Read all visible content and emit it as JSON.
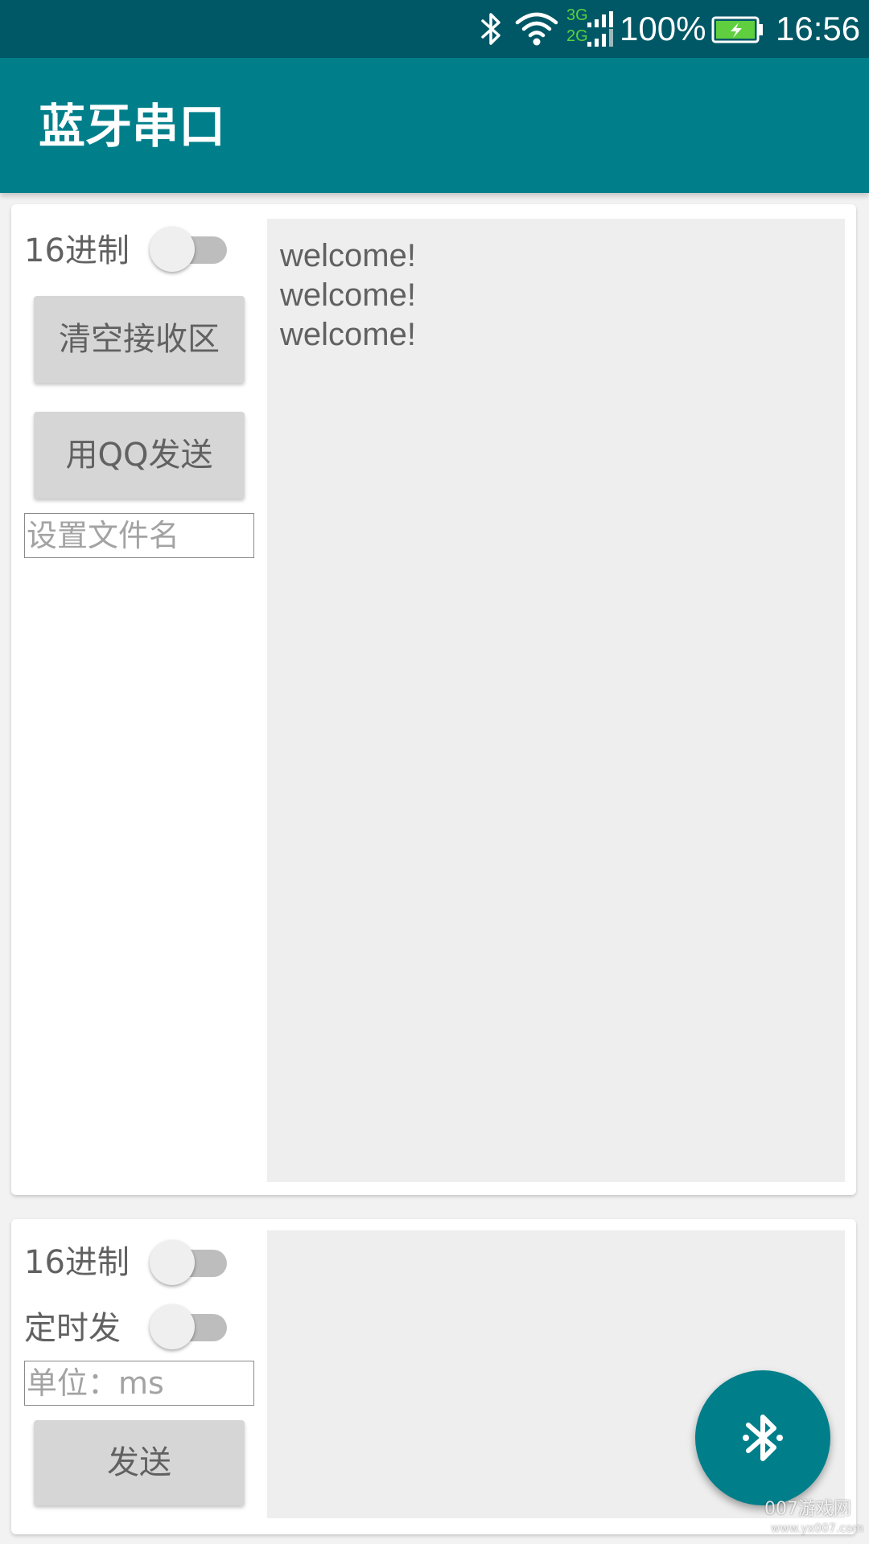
{
  "status_bar": {
    "network_3g": "3G",
    "network_2g": "2G",
    "battery": "100%",
    "time": "16:56",
    "icons": [
      "bluetooth-icon",
      "wifi-icon",
      "signal-icon",
      "battery-charging-icon"
    ]
  },
  "app_bar": {
    "title": "蓝牙串口"
  },
  "receive": {
    "hex_label": "16进制",
    "hex_enabled": false,
    "clear_button": "清空接收区",
    "qq_button": "用QQ发送",
    "filename_placeholder": "设置文件名",
    "filename_value": "",
    "lines": [
      "welcome!",
      "welcome!",
      "welcome!"
    ]
  },
  "send": {
    "hex_label": "16进制",
    "hex_enabled": false,
    "timer_label": "定时发",
    "timer_enabled": false,
    "interval_placeholder": "单位：ms",
    "interval_value": "",
    "send_button": "发送",
    "input_value": ""
  },
  "fab": {
    "icon": "bluetooth-icon"
  },
  "watermark": {
    "text": "007游戏网",
    "url": "www.yx007.com"
  },
  "colors": {
    "status_bar": "#005866",
    "primary": "#007f8b",
    "card": "#ffffff",
    "text_area": "#eeeeee",
    "button": "#d6d6d6",
    "text": "#616161",
    "signal_green": "#5fcf3f"
  }
}
